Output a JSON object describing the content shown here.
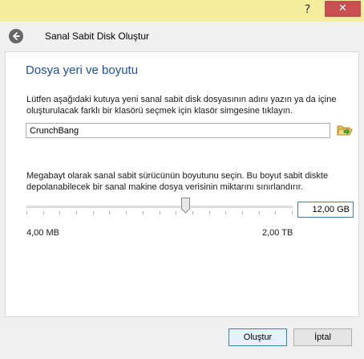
{
  "window": {
    "help_label": "?",
    "close_label": "✕"
  },
  "header": {
    "title": "Sanal Sabit Disk Oluştur"
  },
  "section": {
    "title": "Dosya yeri ve boyutu",
    "location_instructions": "Lütfen aşağıdaki kutuya yeni sanal sabit disk dosyasının adını yazın ya da içine oluşturulacak farklı bir klasörü seçmek için klasör simgesine tıklayın.",
    "size_instructions": "Megabayt olarak sanal sabit sürücünün boyutunu seçin. Bu boyut sabit diskte depolanabilecek bir sanal makine dosya verisinin miktarını sınırlandırır."
  },
  "file_location": {
    "value": "CrunchBang"
  },
  "size": {
    "value": "12,00 GB",
    "min_label": "4,00 MB",
    "max_label": "2,00 TB",
    "slider_fraction": 0.6
  },
  "buttons": {
    "create": "Oluştur",
    "cancel": "İptal"
  },
  "icons": {
    "back": "back-arrow-icon",
    "folder": "folder-open-icon",
    "close": "close-icon"
  }
}
